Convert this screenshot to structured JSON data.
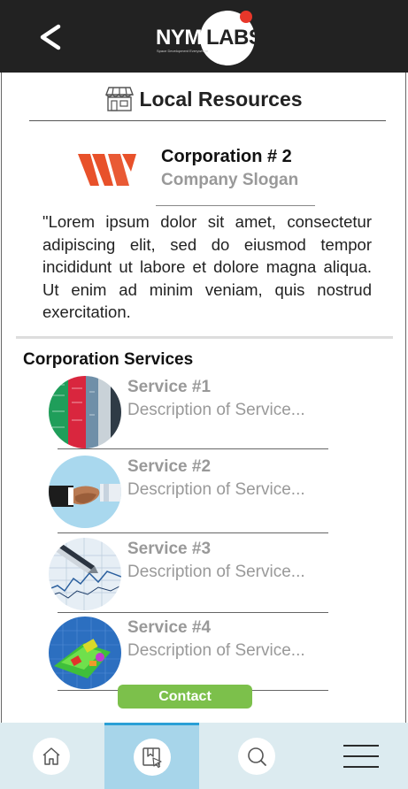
{
  "header": {
    "back_icon": "chevron-left-icon",
    "logo_text_left": "NYM",
    "logo_text_right": "LABS",
    "logo_tagline": "Space Development Everywhere",
    "logo_dot_color": "#e8372a"
  },
  "page": {
    "title": "Local Resources",
    "title_icon": "storefront-icon"
  },
  "corporation": {
    "name": "Corporation # 2",
    "slogan": "Company Slogan",
    "logo_color": "#e8512a",
    "description": "\"Lorem ipsum dolor sit amet, consectetur adipiscing elit, sed do eiusmod tempor incididunt ut labore et dolore magna aliqua. Ut enim ad minim veniam, quis nostrud exercitation."
  },
  "services": {
    "section_title": "Corporation Services",
    "items": [
      {
        "title": "Service #1",
        "description": "Description of Service...",
        "image": "circuit-boards-image"
      },
      {
        "title": "Service #2",
        "description": "Description of Service...",
        "image": "handshake-image"
      },
      {
        "title": "Service #3",
        "description": "Description of Service...",
        "image": "pen-on-chart-image"
      },
      {
        "title": "Service #4",
        "description": "Description of Service...",
        "image": "cad-engine-model-image"
      }
    ]
  },
  "contact": {
    "label": "Contact",
    "color": "#7cc04b"
  },
  "tabbar": {
    "active_color": "#a7d5ea",
    "tabs": [
      {
        "icon": "home-icon",
        "active": false
      },
      {
        "icon": "bookmark-select-icon",
        "active": true
      },
      {
        "icon": "search-icon",
        "active": false
      },
      {
        "icon": "menu-icon",
        "active": false
      }
    ]
  }
}
